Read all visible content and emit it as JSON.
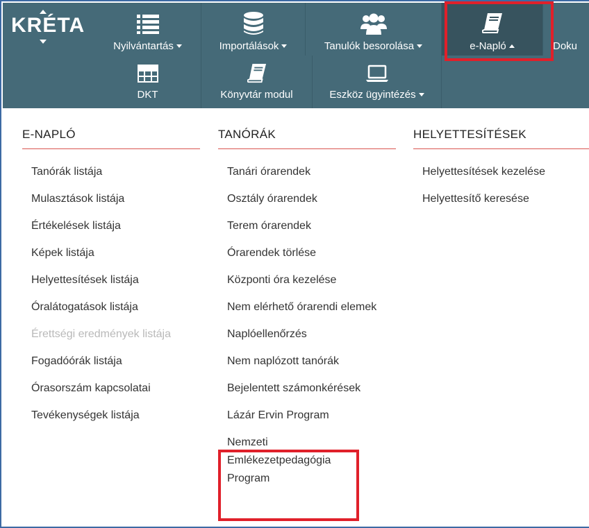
{
  "brand": {
    "logo_text": "KRÉTA"
  },
  "nav": {
    "row1": [
      {
        "label": "Nyilvántartás",
        "icon": "list-icon",
        "caret": "down"
      },
      {
        "label": "Importálások",
        "icon": "database-icon",
        "caret": "down"
      },
      {
        "label": "Tanulók besorolása",
        "icon": "users-icon",
        "caret": "down"
      },
      {
        "label": "e-Napló",
        "icon": "book-icon",
        "caret": "up"
      },
      {
        "label": "Doku"
      }
    ],
    "row2": [
      {
        "label": "DKT",
        "icon": "grid-icon"
      },
      {
        "label": "Könyvtár modul",
        "icon": "book-icon"
      },
      {
        "label": "Eszköz ügyintézés",
        "icon": "laptop-icon",
        "caret": "down"
      }
    ]
  },
  "menu": {
    "enaplo": {
      "title": "E-NAPLÓ",
      "items": [
        "Tanórák listája",
        "Mulasztások listája",
        "Értékelések listája",
        "Képek listája",
        "Helyettesítések listája",
        "Óralátogatások listája",
        "Érettségi eredmények listája",
        "Fogadóórák listája",
        "Órasorszám kapcsolatai",
        "Tevékenységek listája"
      ]
    },
    "tanorak": {
      "title": "TANÓRÁK",
      "items": [
        "Tanári órarendek",
        "Osztály órarendek",
        "Terem órarendek",
        "Órarendek törlése",
        "Központi óra kezelése",
        "Nem elérhető órarendi elemek",
        "Naplóellenőrzés",
        "Nem naplózott tanórák",
        "Bejelentett számonkérések",
        "Lázár Ervin Program",
        "Nemzeti Emlékezetpedagógia Program"
      ]
    },
    "helyettesitesek": {
      "title": "HELYETTESÍTÉSEK",
      "items": [
        "Helyettesítések kezelése",
        "Helyettesítő keresése"
      ]
    }
  },
  "colors": {
    "nav_bg": "#456a78",
    "highlight": "#e0202a",
    "underline": "#d9534f"
  }
}
